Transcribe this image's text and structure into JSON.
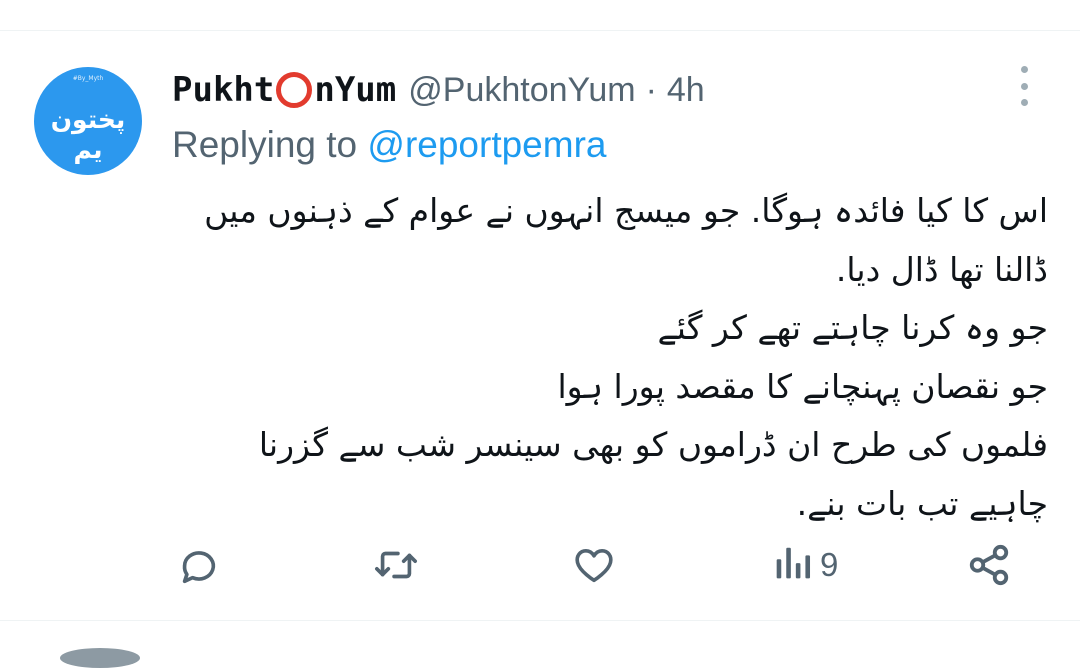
{
  "tweet": {
    "author_name_part1": "Pukht",
    "author_name_part2": "nYum",
    "handle": "@PukhtonYum",
    "separator": "·",
    "time": "4h",
    "reply_prefix": "Replying to",
    "reply_mention": "@reportpemra",
    "avatar": {
      "small_text": "#By_Myth",
      "logo_text": "پختون یم",
      "color": "#2c98ee"
    },
    "body_lines": [
      "اس کا کیا فائدہ ہوگا. جو میسج انہوں نے عوام کے ذہنوں میں",
      "ڈالنا تھا ڈال دیا.",
      "جو وہ کرنا چاہتے تھے کر گئے",
      "جو نقصان پہنچانے کا مقصد پورا ہوا",
      "فلموں کی طرح ان ڈراموں کو بھی سینسر شب سے گزرنا",
      "چاہیے تب بات بنے."
    ],
    "actions": {
      "reply_icon": "reply-bubble-icon",
      "retweet_icon": "retweet-icon",
      "like_icon": "heart-icon",
      "views_icon": "analytics-bars-icon",
      "views_count": "9",
      "share_icon": "share-icon"
    }
  },
  "colors": {
    "accent": "#1d9bf0",
    "secondary_text": "#536471",
    "ring": "#e23b2e"
  }
}
